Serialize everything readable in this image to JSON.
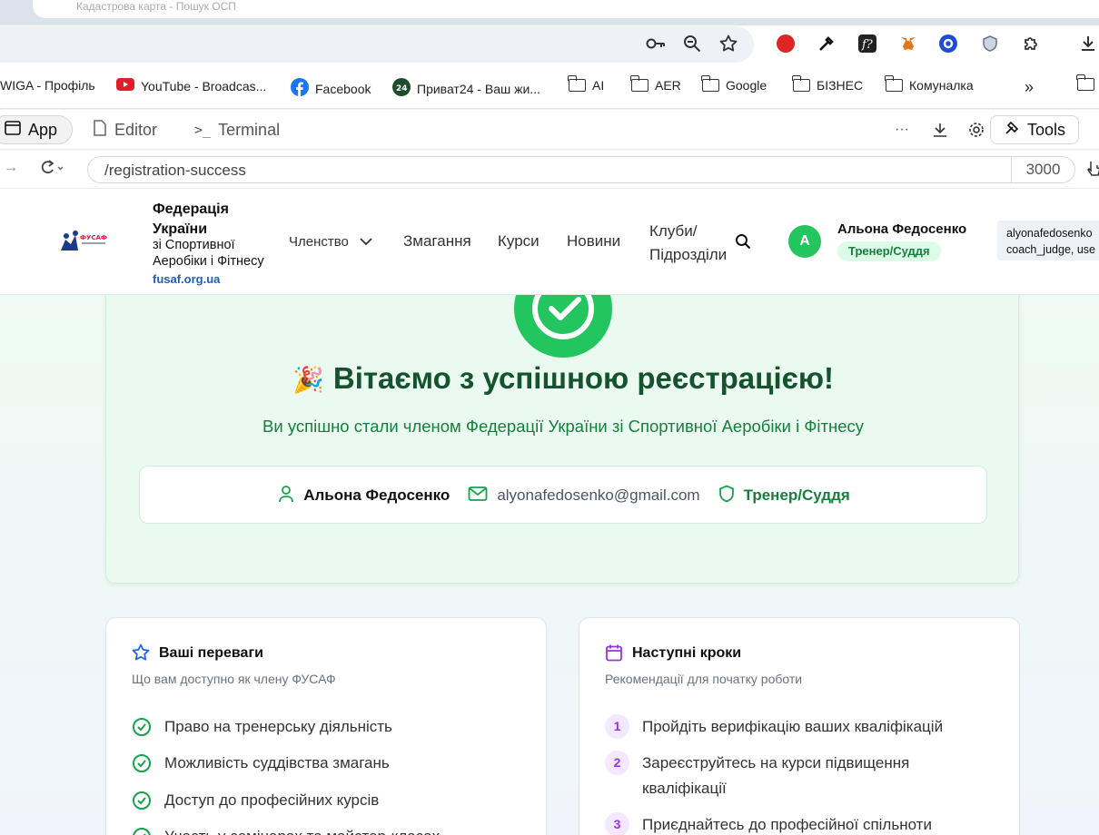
{
  "browser": {
    "tab_title": "Кадастрова карта - Пошук ОСП",
    "bookmarks": [
      {
        "label": "WIGA - Профіль",
        "icon": "none"
      },
      {
        "label": "YouTube - Broadcas...",
        "icon": "youtube-icon"
      },
      {
        "label": "Facebook",
        "icon": "facebook-icon"
      },
      {
        "label": "Приват24 - Ваш жи...",
        "icon": "privat24-icon"
      },
      {
        "label": "AI",
        "icon": "folder-icon"
      },
      {
        "label": "AER",
        "icon": "folder-icon"
      },
      {
        "label": "Google",
        "icon": "folder-icon"
      },
      {
        "label": "БІЗНЕС",
        "icon": "folder-icon"
      },
      {
        "label": "Комуналка",
        "icon": "folder-icon"
      }
    ]
  },
  "replit": {
    "tabs": {
      "app": "App",
      "editor": "Editor",
      "terminal": "Terminal"
    },
    "tools_label": "Tools",
    "url_path": "/registration-success",
    "port": "3000"
  },
  "site": {
    "brand": {
      "logo_text": "ФУСАФ",
      "title": "Федерація України",
      "subtitle": "зі Спортивної Аеробіки і Фітнесу",
      "url": "fusaf.org.ua"
    },
    "nav": {
      "membership": "Членство",
      "competitions": "Змагання",
      "courses": "Курси",
      "news": "Новини",
      "clubs": "Клуби/ Підрозділи"
    },
    "user": {
      "initial": "А",
      "name": "Альона Федосенко",
      "role": "Тренер/Суддя",
      "debug_line1": "alyonafedosenko",
      "debug_line2": "coach_judge, use"
    }
  },
  "hero": {
    "emoji": "🎉",
    "title": "Вітаємо з успішною реєстрацією!",
    "subtitle": "Ви успішно стали членом Федерації України зі Спортивної Аеробіки і Фітнесу",
    "name": "Альона Федосенко",
    "email": "alyonafedosenko@gmail.com",
    "role": "Тренер/Суддя"
  },
  "benefits": {
    "title": "Ваші переваги",
    "subtitle": "Що вам доступно як члену ФУСАФ",
    "items": [
      "Право на тренерську діяльність",
      "Можливість суддівства змагань",
      "Доступ до професійних курсів",
      "Участь у семінарах та майстер-класах"
    ]
  },
  "next_steps": {
    "title": "Наступні кроки",
    "subtitle": "Рекомендації для початку роботи",
    "items": [
      {
        "num": "1",
        "text": "Пройдіть верифікацію ваших кваліфікацій"
      },
      {
        "num": "2",
        "text": "Зареєструйтесь на курси підвищення кваліфікації"
      },
      {
        "num": "3",
        "text": "Приєднайтесь до професійної спільноти"
      }
    ]
  },
  "colors": {
    "accent_green": "#22c55e",
    "dark_green": "#14532d",
    "purple": "#9333ea"
  }
}
